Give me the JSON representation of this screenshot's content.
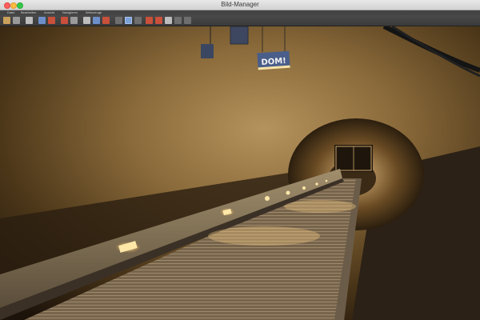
{
  "window": {
    "title": "Bild-Manager"
  },
  "menu": {
    "items": [
      "Datei",
      "Bearbeiten",
      "Ansicht",
      "Navigieren",
      "Werkzeuge"
    ]
  },
  "toolbar": {
    "icons": [
      "open-folder-icon",
      "save-icon",
      "print-icon",
      "rotate-left-icon",
      "rotate-right-icon",
      "delete-icon",
      "edit-icon",
      "slideshow-icon",
      "thumbnail-icon",
      "fullscreen-icon",
      "view-single-icon",
      "view-grid-icon",
      "view-list-icon",
      "zoom-in-icon",
      "zoom-out-icon",
      "fit-icon",
      "previous-icon",
      "next-icon",
      "info-icon"
    ]
  },
  "image": {
    "sign_text": "DOM!"
  }
}
